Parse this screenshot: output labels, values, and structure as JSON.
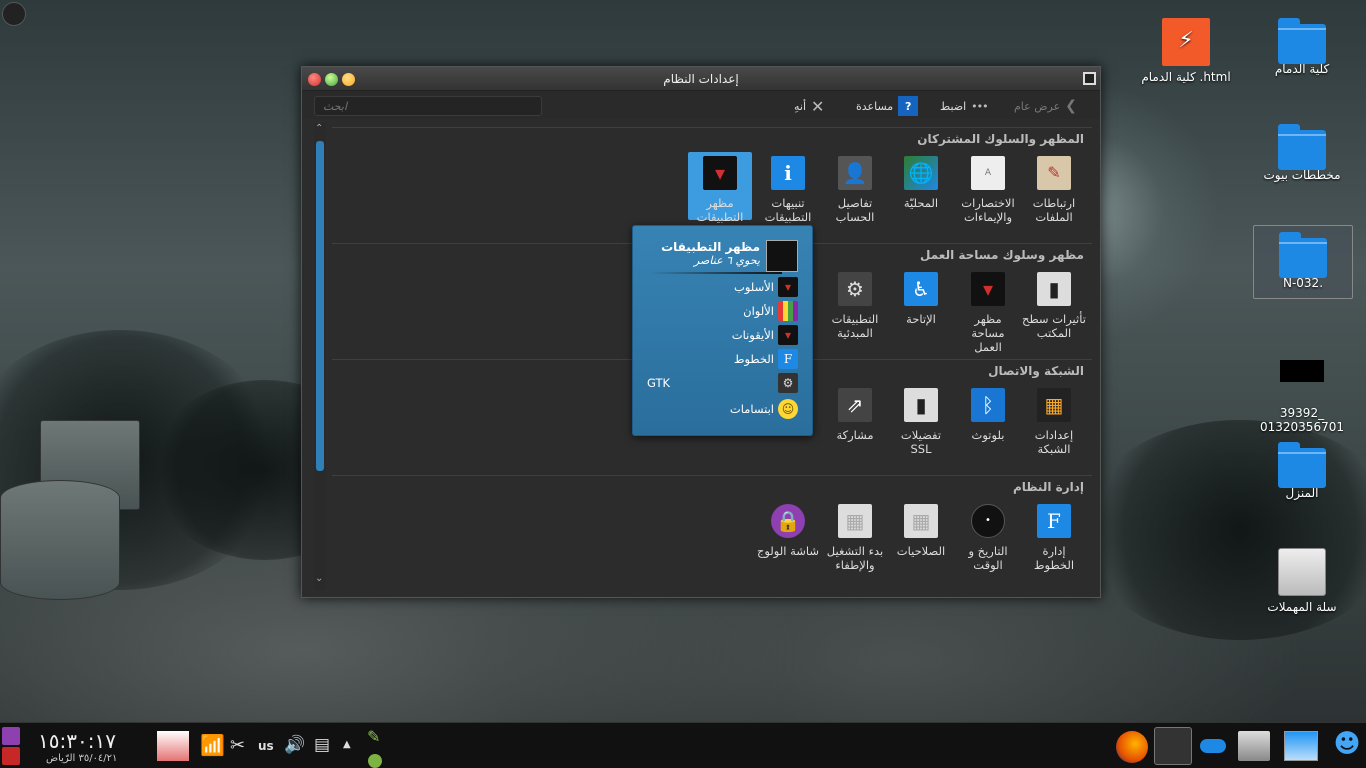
{
  "desktop": {
    "icons": [
      {
        "label": "كلية الدمام"
      },
      {
        "label": "كلية الدمام .html"
      },
      {
        "label": "مخططات بيوت"
      },
      {
        "label": "N-032."
      },
      {
        "label": "39392_\n01320356701"
      },
      {
        "label": "المنزل"
      },
      {
        "label": "سلة المهملات"
      }
    ]
  },
  "window": {
    "title": "إعدادات النظام",
    "toolbar": {
      "overview": "عرض عام",
      "configure": "اضبط",
      "help": "مساعدة",
      "quit": "أنهِ",
      "search_placeholder": "ابحث"
    },
    "sections": [
      {
        "title": "المظهر والسلوك المشتركان",
        "items": [
          {
            "label": "ارتباطات الملفات",
            "icon": "file-associations-icon"
          },
          {
            "label": "الاختصارات والإيماءات",
            "icon": "shortcuts-icon"
          },
          {
            "label": "المحليّة",
            "icon": "globe-icon"
          },
          {
            "label": "تفاصيل الحساب",
            "icon": "user-icon"
          },
          {
            "label": "تنبيهات التطبيقات والنظام",
            "icon": "info-icon"
          },
          {
            "label": "مظهر التطبيقات",
            "icon": "tuxedo-icon"
          }
        ]
      },
      {
        "title": "مظهر وسلوك مساحة العمل",
        "items": [
          {
            "label": "تأثيرات سطح المكتب",
            "icon": "desktop-effects-icon"
          },
          {
            "label": "مظهر مساحة العمل",
            "icon": "tuxedo-icon"
          },
          {
            "label": "الإتاحة",
            "icon": "accessibility-icon"
          },
          {
            "label": "التطبيقات المبدئية",
            "icon": "gears-icon"
          }
        ]
      },
      {
        "title": "الشبكة والاتصال",
        "items": [
          {
            "label": "إعدادات الشبكة",
            "icon": "network-icon"
          },
          {
            "label": "بلوتوث",
            "icon": "bluetooth-icon"
          },
          {
            "label": "تفضيلات SSL",
            "icon": "ssl-icon"
          },
          {
            "label": "مشاركة",
            "icon": "share-icon"
          }
        ]
      },
      {
        "title": "إدارة النظام",
        "items": [
          {
            "label": "إدارة الخطوط",
            "icon": "font-icon"
          },
          {
            "label": "التاريخ و الوقت",
            "icon": "clock-icon"
          },
          {
            "label": "الصلاحيات",
            "icon": "permissions-icon"
          },
          {
            "label": "بدء التشغيل والإطفاء",
            "icon": "startup-icon"
          },
          {
            "label": "شاشة الولوج",
            "icon": "lock-icon"
          }
        ]
      }
    ]
  },
  "popup": {
    "title": "مظهر التطبيقات",
    "subtitle": "يحوي ٦ عناصر",
    "items": [
      {
        "label": "الأسلوب",
        "icon": "tuxedo-icon"
      },
      {
        "label": "الألوان",
        "icon": "colors-icon"
      },
      {
        "label": "الأيقونات",
        "icon": "tuxedo-icon"
      },
      {
        "label": "الخطوط",
        "icon": "font-icon"
      },
      {
        "label": "GTK",
        "icon": "gtk-icon"
      },
      {
        "label": "ابتسامات",
        "icon": "smiley-icon"
      }
    ]
  },
  "taskbar": {
    "clock": "١٥:٣٠:١٧",
    "date": "٣٥/٠٤/٢١ الرّياض",
    "keyboard_layout": "us"
  },
  "colors": {
    "accent": "#3d9be0",
    "popup_bg": "#3783b4",
    "window_bg": "#2c2c2c"
  }
}
